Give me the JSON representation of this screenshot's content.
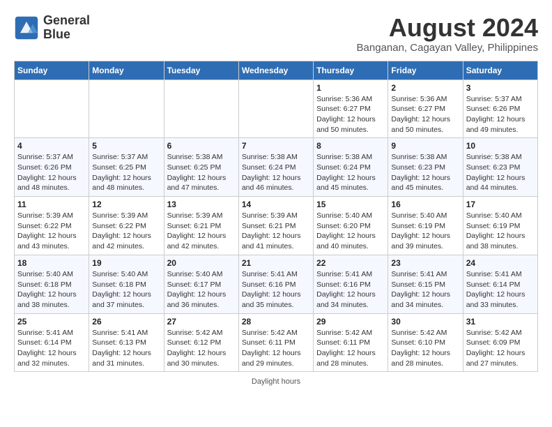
{
  "logo": {
    "line1": "General",
    "line2": "Blue"
  },
  "title": "August 2024",
  "subtitle": "Banganan, Cagayan Valley, Philippines",
  "days_of_week": [
    "Sunday",
    "Monday",
    "Tuesday",
    "Wednesday",
    "Thursday",
    "Friday",
    "Saturday"
  ],
  "footer": "Daylight hours",
  "weeks": [
    [
      {
        "day": "",
        "info": ""
      },
      {
        "day": "",
        "info": ""
      },
      {
        "day": "",
        "info": ""
      },
      {
        "day": "",
        "info": ""
      },
      {
        "day": "1",
        "info": "Sunrise: 5:36 AM\nSunset: 6:27 PM\nDaylight: 12 hours\nand 50 minutes."
      },
      {
        "day": "2",
        "info": "Sunrise: 5:36 AM\nSunset: 6:27 PM\nDaylight: 12 hours\nand 50 minutes."
      },
      {
        "day": "3",
        "info": "Sunrise: 5:37 AM\nSunset: 6:26 PM\nDaylight: 12 hours\nand 49 minutes."
      }
    ],
    [
      {
        "day": "4",
        "info": "Sunrise: 5:37 AM\nSunset: 6:26 PM\nDaylight: 12 hours\nand 48 minutes."
      },
      {
        "day": "5",
        "info": "Sunrise: 5:37 AM\nSunset: 6:25 PM\nDaylight: 12 hours\nand 48 minutes."
      },
      {
        "day": "6",
        "info": "Sunrise: 5:38 AM\nSunset: 6:25 PM\nDaylight: 12 hours\nand 47 minutes."
      },
      {
        "day": "7",
        "info": "Sunrise: 5:38 AM\nSunset: 6:24 PM\nDaylight: 12 hours\nand 46 minutes."
      },
      {
        "day": "8",
        "info": "Sunrise: 5:38 AM\nSunset: 6:24 PM\nDaylight: 12 hours\nand 45 minutes."
      },
      {
        "day": "9",
        "info": "Sunrise: 5:38 AM\nSunset: 6:23 PM\nDaylight: 12 hours\nand 45 minutes."
      },
      {
        "day": "10",
        "info": "Sunrise: 5:38 AM\nSunset: 6:23 PM\nDaylight: 12 hours\nand 44 minutes."
      }
    ],
    [
      {
        "day": "11",
        "info": "Sunrise: 5:39 AM\nSunset: 6:22 PM\nDaylight: 12 hours\nand 43 minutes."
      },
      {
        "day": "12",
        "info": "Sunrise: 5:39 AM\nSunset: 6:22 PM\nDaylight: 12 hours\nand 42 minutes."
      },
      {
        "day": "13",
        "info": "Sunrise: 5:39 AM\nSunset: 6:21 PM\nDaylight: 12 hours\nand 42 minutes."
      },
      {
        "day": "14",
        "info": "Sunrise: 5:39 AM\nSunset: 6:21 PM\nDaylight: 12 hours\nand 41 minutes."
      },
      {
        "day": "15",
        "info": "Sunrise: 5:40 AM\nSunset: 6:20 PM\nDaylight: 12 hours\nand 40 minutes."
      },
      {
        "day": "16",
        "info": "Sunrise: 5:40 AM\nSunset: 6:19 PM\nDaylight: 12 hours\nand 39 minutes."
      },
      {
        "day": "17",
        "info": "Sunrise: 5:40 AM\nSunset: 6:19 PM\nDaylight: 12 hours\nand 38 minutes."
      }
    ],
    [
      {
        "day": "18",
        "info": "Sunrise: 5:40 AM\nSunset: 6:18 PM\nDaylight: 12 hours\nand 38 minutes."
      },
      {
        "day": "19",
        "info": "Sunrise: 5:40 AM\nSunset: 6:18 PM\nDaylight: 12 hours\nand 37 minutes."
      },
      {
        "day": "20",
        "info": "Sunrise: 5:40 AM\nSunset: 6:17 PM\nDaylight: 12 hours\nand 36 minutes."
      },
      {
        "day": "21",
        "info": "Sunrise: 5:41 AM\nSunset: 6:16 PM\nDaylight: 12 hours\nand 35 minutes."
      },
      {
        "day": "22",
        "info": "Sunrise: 5:41 AM\nSunset: 6:16 PM\nDaylight: 12 hours\nand 34 minutes."
      },
      {
        "day": "23",
        "info": "Sunrise: 5:41 AM\nSunset: 6:15 PM\nDaylight: 12 hours\nand 34 minutes."
      },
      {
        "day": "24",
        "info": "Sunrise: 5:41 AM\nSunset: 6:14 PM\nDaylight: 12 hours\nand 33 minutes."
      }
    ],
    [
      {
        "day": "25",
        "info": "Sunrise: 5:41 AM\nSunset: 6:14 PM\nDaylight: 12 hours\nand 32 minutes."
      },
      {
        "day": "26",
        "info": "Sunrise: 5:41 AM\nSunset: 6:13 PM\nDaylight: 12 hours\nand 31 minutes."
      },
      {
        "day": "27",
        "info": "Sunrise: 5:42 AM\nSunset: 6:12 PM\nDaylight: 12 hours\nand 30 minutes."
      },
      {
        "day": "28",
        "info": "Sunrise: 5:42 AM\nSunset: 6:11 PM\nDaylight: 12 hours\nand 29 minutes."
      },
      {
        "day": "29",
        "info": "Sunrise: 5:42 AM\nSunset: 6:11 PM\nDaylight: 12 hours\nand 28 minutes."
      },
      {
        "day": "30",
        "info": "Sunrise: 5:42 AM\nSunset: 6:10 PM\nDaylight: 12 hours\nand 28 minutes."
      },
      {
        "day": "31",
        "info": "Sunrise: 5:42 AM\nSunset: 6:09 PM\nDaylight: 12 hours\nand 27 minutes."
      }
    ]
  ]
}
